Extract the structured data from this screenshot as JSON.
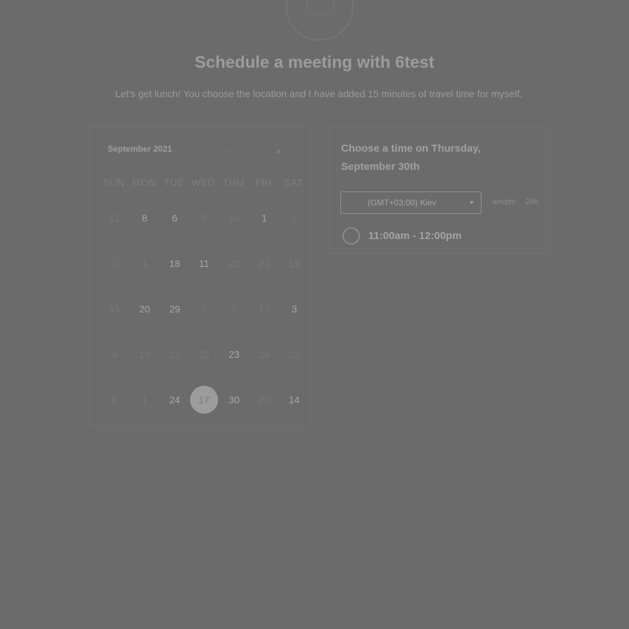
{
  "header": {
    "title": "Schedule a meeting with 6test",
    "subtitle": "Let's get lunch! You choose the location and I have added 15 minutes of travel time for myself."
  },
  "calendar": {
    "month_label": "September 2021",
    "prev_icon": "chevron-left-icon",
    "next_icon": "chevron-right-icon",
    "weekdays": [
      "SUN",
      "MON",
      "TUE",
      "WED",
      "THU",
      "FRI",
      "SAT"
    ],
    "weeks": [
      [
        "12",
        "8",
        "6",
        "5",
        "10",
        "1",
        "2"
      ],
      [
        "1",
        "1",
        "18",
        "11",
        "22",
        "21",
        "19"
      ],
      [
        "15",
        "20",
        "29",
        "1",
        "9",
        "17",
        "3"
      ],
      [
        "4",
        "10",
        "21",
        "22",
        "23",
        "24",
        "25"
      ],
      [
        "6",
        "1",
        "24",
        "17",
        "30",
        "20",
        "14"
      ]
    ],
    "active": [
      [
        false,
        true,
        true,
        false,
        false,
        true,
        false
      ],
      [
        false,
        false,
        true,
        true,
        false,
        false,
        false
      ],
      [
        false,
        true,
        true,
        false,
        false,
        false,
        true
      ],
      [
        false,
        false,
        false,
        false,
        true,
        false,
        false
      ],
      [
        false,
        false,
        true,
        true,
        true,
        false,
        true
      ]
    ],
    "selected_day": "17"
  },
  "time_panel": {
    "heading": "Choose a time on Thursday, September 30th",
    "timezone_value": "(GMT+03:00) Kiev",
    "format_ampm": "am/pm",
    "format_24h": "24h",
    "slots": [
      "11:00am - 12:00pm"
    ]
  },
  "colors": {
    "overlay": "#6b6b6b",
    "text_active": "#a6a6a6",
    "text_dim": "#777777"
  }
}
